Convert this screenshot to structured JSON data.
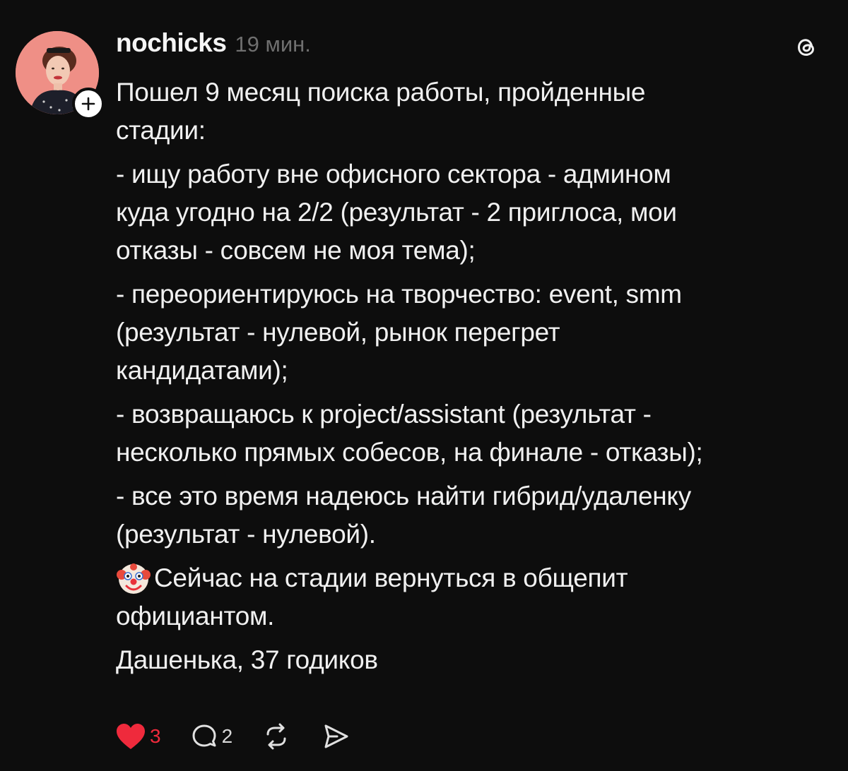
{
  "post": {
    "username": "nochicks",
    "timestamp": "19 мин.",
    "paragraphs": [
      [
        "Пошел 9 месяц поиска работы, пройденные",
        "стадии:"
      ],
      [
        "- ищу работу вне офисного сектора - админом",
        "куда угодно на 2/2 (результат - 2 приглоса, мои",
        "отказы - совсем не моя тема);"
      ],
      [
        "- переориентируюсь на творчество: event, smm",
        "(результат - нулевой, рынок перегрет",
        "кандидатами);"
      ],
      [
        "- возвращаюсь к project/assistant (результат -",
        "несколько прямых собесов, на финале - отказы);"
      ],
      [
        "- все это время надеюсь найти гибрид/удаленку",
        "(результат - нулевой)."
      ],
      [
        "Сейчас на стадии вернуться в общепит",
        "официантом."
      ],
      [
        "Дашенька, 37 годиков"
      ]
    ],
    "emoji_icon": "clown-face-icon"
  },
  "actions": {
    "likes": "3",
    "replies": "2",
    "liked": true,
    "icons": [
      "heart-icon",
      "comment-icon",
      "repost-icon",
      "share-icon"
    ]
  },
  "colors": {
    "background": "#0d0d0d",
    "text": "#f0f0f0",
    "muted": "#6f6f6f",
    "like": "#ef2a3c",
    "avatar_bg": "#ef8f86"
  }
}
